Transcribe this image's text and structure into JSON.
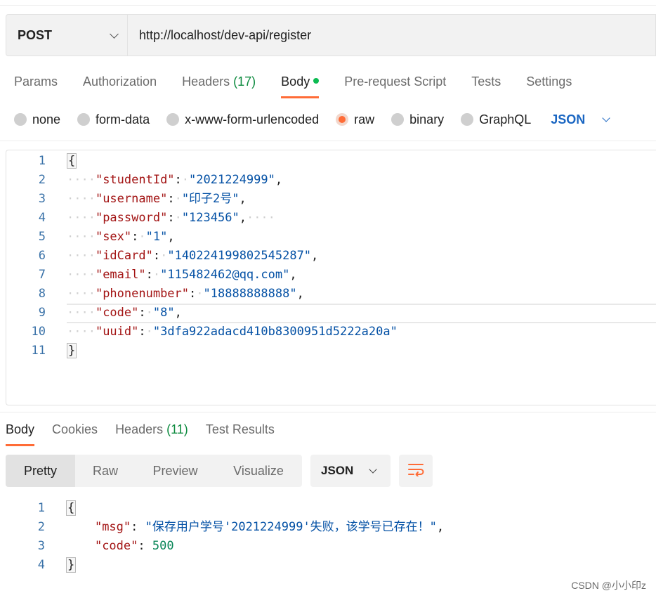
{
  "request": {
    "method": "POST",
    "url": "http://localhost/dev-api/register"
  },
  "request_tabs": [
    {
      "label": "Params",
      "count": ""
    },
    {
      "label": "Authorization",
      "count": ""
    },
    {
      "label": "Headers",
      "count": "(17)"
    },
    {
      "label": "Body",
      "count": ""
    },
    {
      "label": "Pre-request Script",
      "count": ""
    },
    {
      "label": "Tests",
      "count": ""
    },
    {
      "label": "Settings",
      "count": ""
    }
  ],
  "active_request_tab": "Body",
  "body_types": [
    {
      "label": "none",
      "selected": false
    },
    {
      "label": "form-data",
      "selected": false
    },
    {
      "label": "x-www-form-urlencoded",
      "selected": false
    },
    {
      "label": "raw",
      "selected": true
    },
    {
      "label": "binary",
      "selected": false
    },
    {
      "label": "GraphQL",
      "selected": false
    }
  ],
  "raw_format": "JSON",
  "request_body": [
    {
      "n": "1",
      "tokens": [
        [
          "brace",
          "{"
        ]
      ]
    },
    {
      "n": "2",
      "tokens": [
        [
          "ws",
          "····"
        ],
        [
          "key",
          "\"studentId\""
        ],
        [
          "punc",
          ":"
        ],
        [
          "ws",
          "·"
        ],
        [
          "str",
          "\"2021224999\""
        ],
        [
          "punc",
          ","
        ]
      ]
    },
    {
      "n": "3",
      "tokens": [
        [
          "ws",
          "····"
        ],
        [
          "key",
          "\"username\""
        ],
        [
          "punc",
          ":"
        ],
        [
          "ws",
          "·"
        ],
        [
          "str",
          "\"印子2号\""
        ],
        [
          "punc",
          ","
        ]
      ]
    },
    {
      "n": "4",
      "tokens": [
        [
          "ws",
          "····"
        ],
        [
          "key",
          "\"password\""
        ],
        [
          "punc",
          ":"
        ],
        [
          "ws",
          "·"
        ],
        [
          "str",
          "\"123456\""
        ],
        [
          "punc",
          ","
        ],
        [
          "ws",
          "····"
        ]
      ]
    },
    {
      "n": "5",
      "tokens": [
        [
          "ws",
          "····"
        ],
        [
          "key",
          "\"sex\""
        ],
        [
          "punc",
          ":"
        ],
        [
          "ws",
          "·"
        ],
        [
          "str",
          "\"1\""
        ],
        [
          "punc",
          ","
        ]
      ]
    },
    {
      "n": "6",
      "tokens": [
        [
          "ws",
          "····"
        ],
        [
          "key",
          "\"idCard\""
        ],
        [
          "punc",
          ":"
        ],
        [
          "ws",
          "·"
        ],
        [
          "str",
          "\"140224199802545287\""
        ],
        [
          "punc",
          ","
        ]
      ]
    },
    {
      "n": "7",
      "tokens": [
        [
          "ws",
          "····"
        ],
        [
          "key",
          "\"email\""
        ],
        [
          "punc",
          ":"
        ],
        [
          "ws",
          "·"
        ],
        [
          "str",
          "\"115482462@qq.com\""
        ],
        [
          "punc",
          ","
        ]
      ]
    },
    {
      "n": "8",
      "tokens": [
        [
          "ws",
          "····"
        ],
        [
          "key",
          "\"phonenumber\""
        ],
        [
          "punc",
          ":"
        ],
        [
          "ws",
          "·"
        ],
        [
          "str",
          "\"18888888888\""
        ],
        [
          "punc",
          ","
        ]
      ]
    },
    {
      "n": "9",
      "tokens": [
        [
          "ws",
          "····"
        ],
        [
          "key",
          "\"code\""
        ],
        [
          "punc",
          ":"
        ],
        [
          "ws",
          "·"
        ],
        [
          "str",
          "\"8\""
        ],
        [
          "punc",
          ","
        ]
      ]
    },
    {
      "n": "10",
      "tokens": [
        [
          "ws",
          "····"
        ],
        [
          "key",
          "\"uuid\""
        ],
        [
          "punc",
          ":"
        ],
        [
          "ws",
          "·"
        ],
        [
          "str",
          "\"3dfa922adacd410b8300951d5222a20a\""
        ]
      ]
    },
    {
      "n": "11",
      "tokens": [
        [
          "brace",
          "}"
        ]
      ]
    }
  ],
  "response_tabs": [
    {
      "label": "Body",
      "count": ""
    },
    {
      "label": "Cookies",
      "count": ""
    },
    {
      "label": "Headers",
      "count": "(11)"
    },
    {
      "label": "Test Results",
      "count": ""
    }
  ],
  "active_response_tab": "Body",
  "view_modes": [
    "Pretty",
    "Raw",
    "Preview",
    "Visualize"
  ],
  "active_view_mode": "Pretty",
  "response_format": "JSON",
  "response_body": [
    {
      "n": "1",
      "tokens": [
        [
          "brace",
          "{"
        ]
      ]
    },
    {
      "n": "2",
      "tokens": [
        [
          "ws",
          "    "
        ],
        [
          "key",
          "\"msg\""
        ],
        [
          "punc",
          ": "
        ],
        [
          "str",
          "\"保存用户学号'2021224999'失败，该学号已存在！\""
        ],
        [
          "punc",
          ","
        ]
      ]
    },
    {
      "n": "3",
      "tokens": [
        [
          "ws",
          "    "
        ],
        [
          "key",
          "\"code\""
        ],
        [
          "punc",
          ": "
        ],
        [
          "num",
          "500"
        ]
      ]
    },
    {
      "n": "4",
      "tokens": [
        [
          "brace",
          "}"
        ]
      ]
    }
  ],
  "watermark": "CSDN @小小印z",
  "colors": {
    "accent": "#ff6c37",
    "json_blue": "#1a66c2",
    "count_green": "#0c8a3e",
    "body_dot": "#0cbb52"
  },
  "icons": [
    "chevron-down-icon",
    "word-wrap-icon"
  ]
}
